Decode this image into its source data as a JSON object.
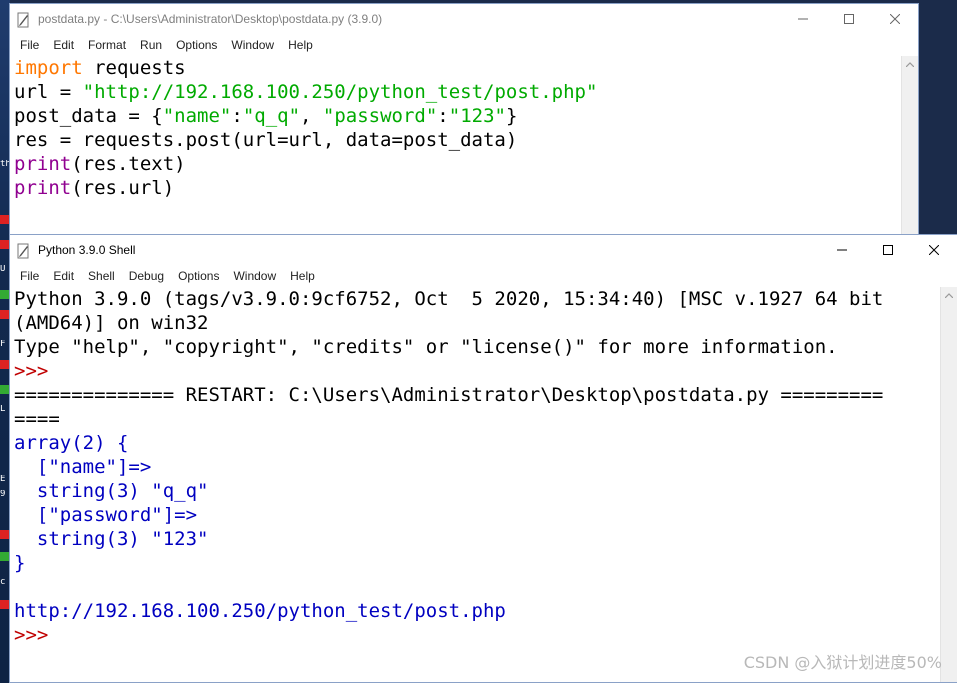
{
  "desktop": {
    "chips": [
      {
        "text": "th",
        "color": "#ffffff"
      },
      {
        "text": "",
        "color": "#d22"
      },
      {
        "text": "",
        "color": "#d22"
      },
      {
        "text": "U",
        "color": "#ffffff"
      },
      {
        "text": "",
        "color": "#3a3"
      },
      {
        "text": "",
        "color": "#d22"
      },
      {
        "text": "F",
        "color": "#ffffff"
      },
      {
        "text": "",
        "color": "#d22"
      },
      {
        "text": "",
        "color": "#3a3"
      },
      {
        "text": "L",
        "color": "#ffffff"
      },
      {
        "text": "E",
        "color": "#ffffff"
      },
      {
        "text": "9",
        "color": "#ffffff"
      },
      {
        "text": "",
        "color": "#d22"
      },
      {
        "text": "",
        "color": "#3a3"
      },
      {
        "text": "c",
        "color": "#ffffff"
      },
      {
        "text": "",
        "color": "#d22"
      }
    ]
  },
  "editor": {
    "title": "postdata.py - C:\\Users\\Administrator\\Desktop\\postdata.py (3.9.0)",
    "menu": [
      "File",
      "Edit",
      "Format",
      "Run",
      "Options",
      "Window",
      "Help"
    ],
    "lines": [
      [
        {
          "t": "import",
          "c": "kw"
        },
        {
          "t": " requests",
          "c": "def"
        }
      ],
      [
        {
          "t": "url = ",
          "c": "def"
        },
        {
          "t": "\"http://192.168.100.250/python_test/post.php\"",
          "c": "str"
        }
      ],
      [
        {
          "t": "post_data = {",
          "c": "def"
        },
        {
          "t": "\"name\"",
          "c": "str"
        },
        {
          "t": ":",
          "c": "def"
        },
        {
          "t": "\"q_q\"",
          "c": "str"
        },
        {
          "t": ", ",
          "c": "def"
        },
        {
          "t": "\"password\"",
          "c": "str"
        },
        {
          "t": ":",
          "c": "def"
        },
        {
          "t": "\"123\"",
          "c": "str"
        },
        {
          "t": "}",
          "c": "def"
        }
      ],
      [
        {
          "t": "res = requests.post(url=url, data=post_data)",
          "c": "def"
        }
      ],
      [
        {
          "t": "print",
          "c": "bi"
        },
        {
          "t": "(res.text)",
          "c": "def"
        }
      ],
      [
        {
          "t": "print",
          "c": "bi"
        },
        {
          "t": "(res.url)",
          "c": "def"
        }
      ]
    ]
  },
  "shell": {
    "title": "Python 3.9.0 Shell",
    "menu": [
      "File",
      "Edit",
      "Shell",
      "Debug",
      "Options",
      "Window",
      "Help"
    ],
    "lines": [
      [
        {
          "t": "Python 3.9.0 (tags/v3.9.0:9cf6752, Oct  5 2020, 15:34:40) [MSC v.1927 64 bit",
          "c": "def"
        }
      ],
      [
        {
          "t": "(AMD64)] on win32",
          "c": "def"
        }
      ],
      [
        {
          "t": "Type \"help\", \"copyright\", \"credits\" or \"license()\" for more information.",
          "c": "def"
        }
      ],
      [
        {
          "t": ">>> ",
          "c": "prompt"
        }
      ],
      [
        {
          "t": "============== RESTART: C:\\Users\\Administrator\\Desktop\\postdata.py =========",
          "c": "def"
        }
      ],
      [
        {
          "t": "====",
          "c": "def"
        }
      ],
      [
        {
          "t": "array(2) {",
          "c": "out"
        }
      ],
      [
        {
          "t": "  [\"name\"]=>",
          "c": "out"
        }
      ],
      [
        {
          "t": "  string(3) \"q_q\"",
          "c": "out"
        }
      ],
      [
        {
          "t": "  [\"password\"]=>",
          "c": "out"
        }
      ],
      [
        {
          "t": "  string(3) \"123\"",
          "c": "out"
        }
      ],
      [
        {
          "t": "}",
          "c": "out"
        }
      ],
      [
        {
          "t": "",
          "c": "out"
        }
      ],
      [
        {
          "t": "http://192.168.100.250/python_test/post.php",
          "c": "out"
        }
      ],
      [
        {
          "t": ">>> ",
          "c": "prompt"
        }
      ]
    ]
  },
  "watermark": "CSDN @入狱计划进度50%"
}
